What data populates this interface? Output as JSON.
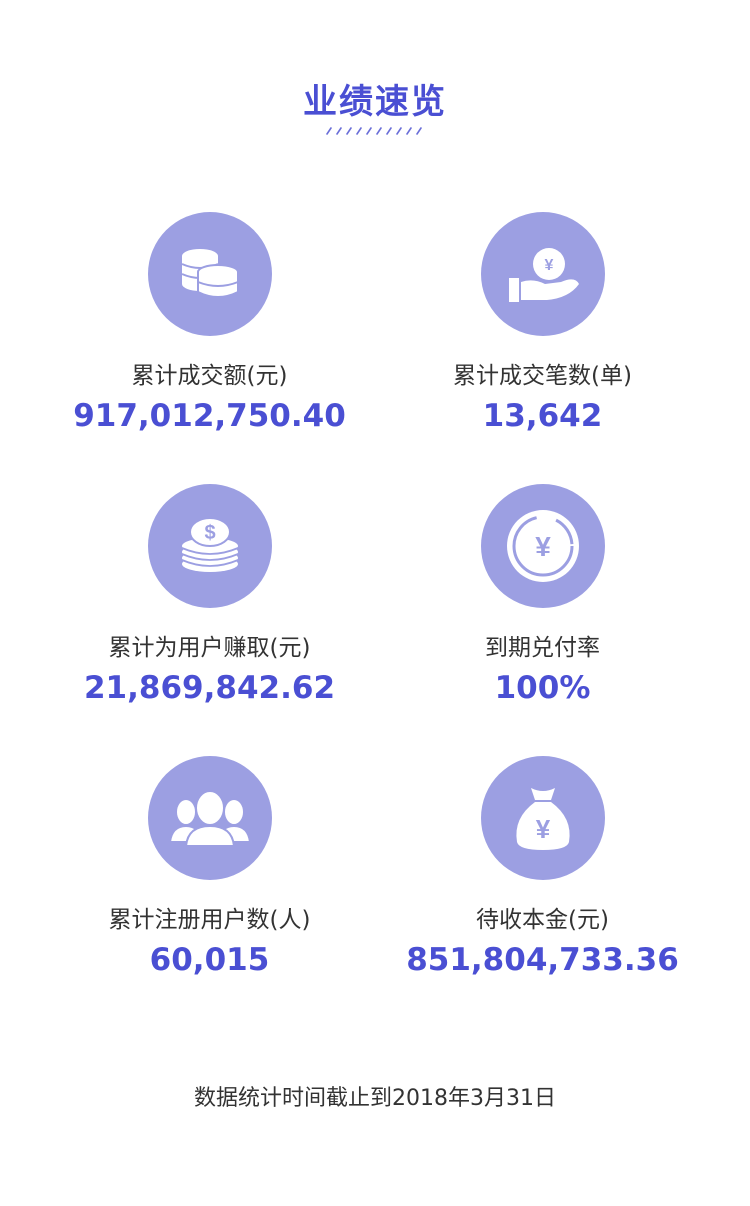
{
  "page": {
    "title": "业绩速览",
    "footer": "数据统计时间截止到2018年3月31日"
  },
  "stats": [
    {
      "label": "累计成交额(元)",
      "value": "917,012,750.40",
      "icon": "coins-stack-icon"
    },
    {
      "label": "累计成交笔数(单)",
      "value": "13,642",
      "icon": "hand-yuan-coin-icon"
    },
    {
      "label": "累计为用户赚取(元)",
      "value": "21,869,842.62",
      "icon": "dollar-coins-icon"
    },
    {
      "label": "到期兑付率",
      "value": "100%",
      "icon": "yuan-coin-ring-icon"
    },
    {
      "label": "累计注册用户数(人)",
      "value": "60,015",
      "icon": "users-group-icon"
    },
    {
      "label": "待收本金(元)",
      "value": "851,804,733.36",
      "icon": "money-bag-icon"
    }
  ],
  "colors": {
    "accent": "#4a4fd3",
    "icon_bg": "#9c9fe2",
    "text": "#333333"
  }
}
